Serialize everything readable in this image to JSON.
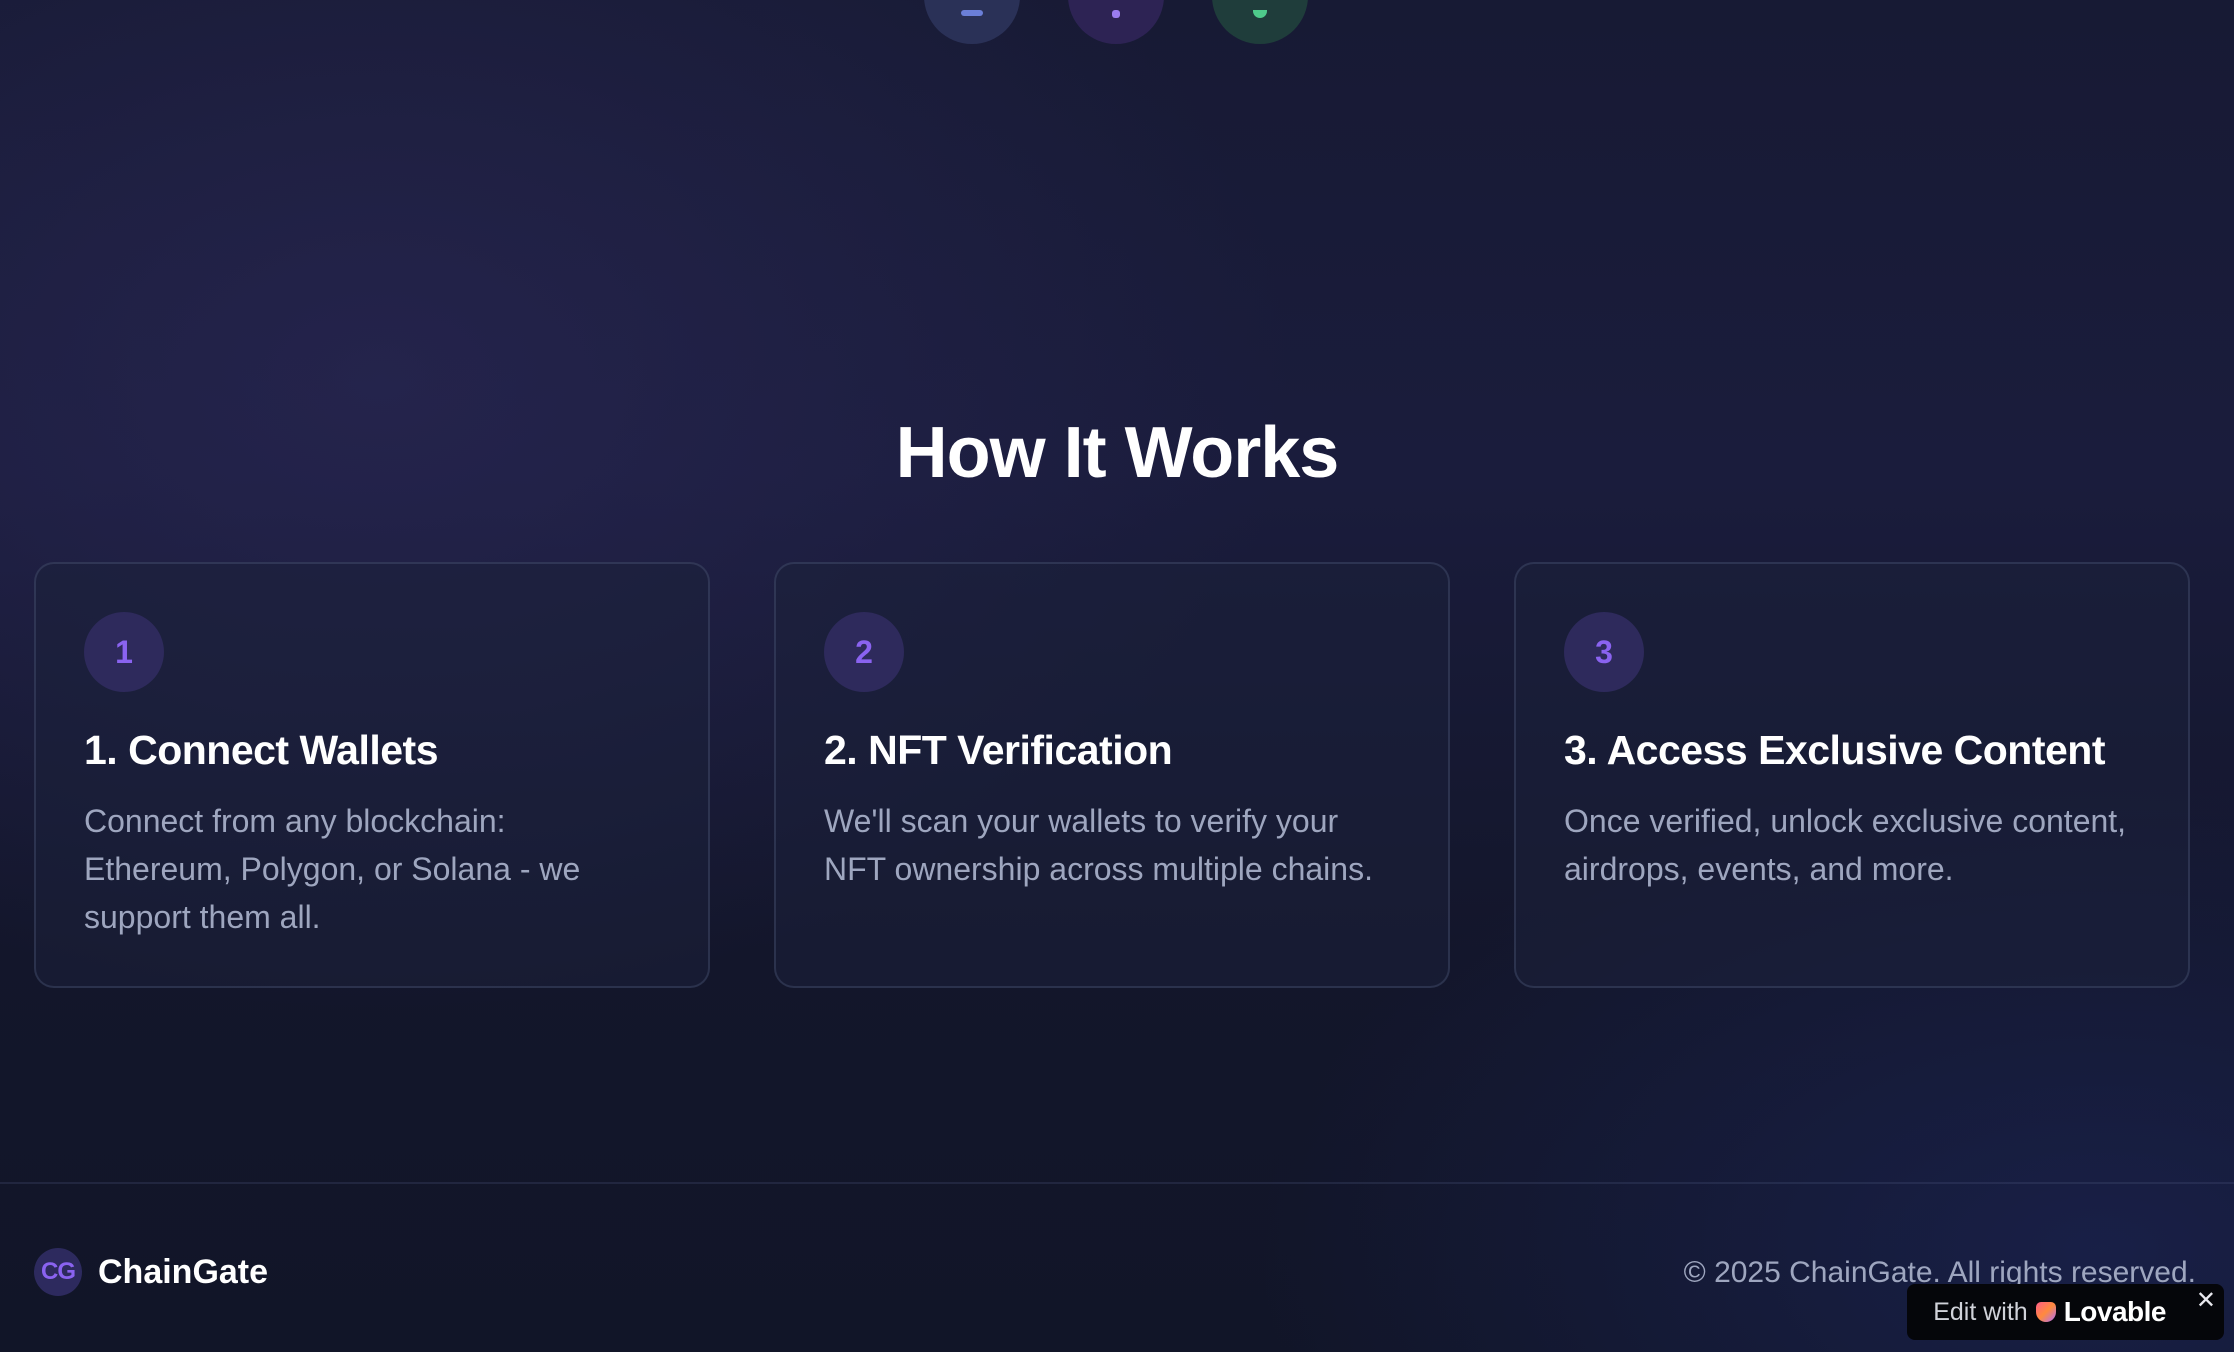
{
  "top_icons": [
    {
      "icon": "ethereum-icon",
      "color": "#6b7fd8"
    },
    {
      "icon": "polygon-icon",
      "color": "#9b7cf0"
    },
    {
      "icon": "solana-icon",
      "color": "#4ecb8b"
    }
  ],
  "how_it_works": {
    "title": "How It Works",
    "steps": [
      {
        "number": "1",
        "title": "1. Connect Wallets",
        "description": "Connect from any blockchain: Ethereum, Polygon, or Solana - we support them all."
      },
      {
        "number": "2",
        "title": "2. NFT Verification",
        "description": "We'll scan your wallets to verify your NFT ownership across multiple chains."
      },
      {
        "number": "3",
        "title": "3. Access Exclusive Content",
        "description": "Once verified, unlock exclusive content, airdrops, events, and more."
      }
    ]
  },
  "footer": {
    "logo_text": "CG",
    "brand_name": "ChainGate",
    "copyright": "© 2025 ChainGate. All rights reserved."
  },
  "lovable_badge": {
    "edit_text": "Edit with",
    "brand_text": "Lovable",
    "close_symbol": "✕"
  },
  "colors": {
    "accent": "#8a63f0",
    "muted_text": "#9ea6bf"
  }
}
